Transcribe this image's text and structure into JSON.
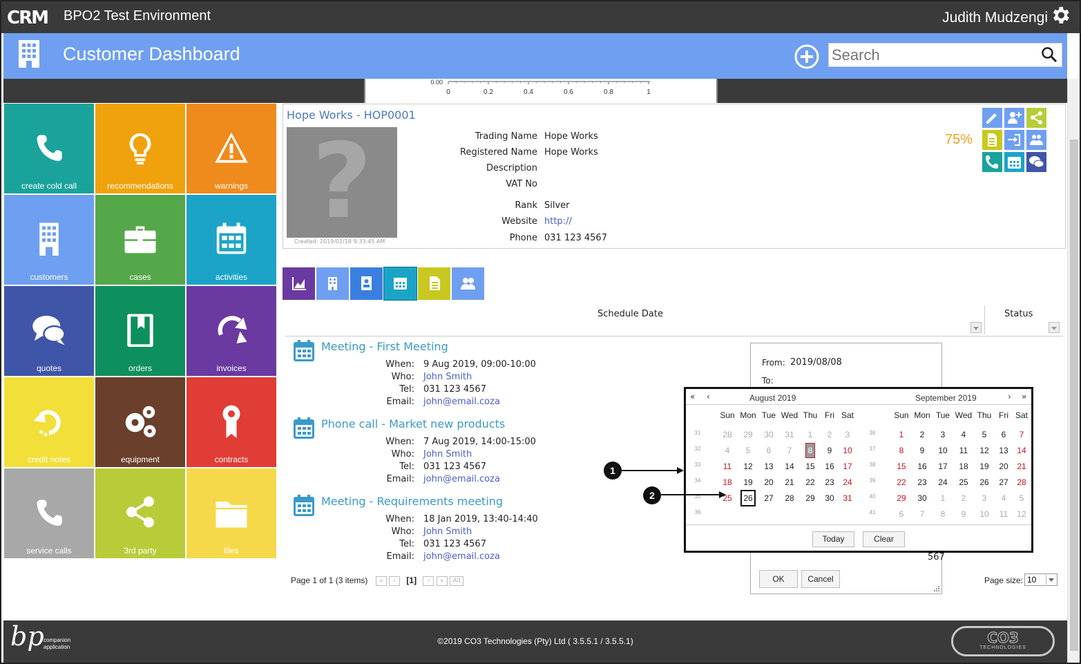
{
  "header": {
    "logo": "CRM",
    "environment": "BPO2 Test Environment",
    "user": "Judith Mudzengi"
  },
  "subheader": {
    "title": "Customer Dashboard",
    "search_placeholder": "Search"
  },
  "chart_axis": {
    "y_label": "0.00",
    "x_ticks": [
      "0",
      "0.2",
      "0.4",
      "0.6",
      "0.8",
      "1"
    ]
  },
  "tiles": [
    {
      "label": "create cold call",
      "color": "#1aa39a",
      "icon": "phone-icon"
    },
    {
      "label": "recommendations",
      "color": "#efa20c",
      "icon": "lightbulb-icon"
    },
    {
      "label": "warnings",
      "color": "#ef8a1c",
      "icon": "warning-icon"
    },
    {
      "label": "customers",
      "color": "#6f9ff0",
      "icon": "building-icon"
    },
    {
      "label": "cases",
      "color": "#55a84a",
      "icon": "briefcase-icon"
    },
    {
      "label": "activities",
      "color": "#1ba4c8",
      "icon": "calendar-icon"
    },
    {
      "label": "quotes",
      "color": "#3f55a8",
      "icon": "chat-icon"
    },
    {
      "label": "orders",
      "color": "#0e8f5e",
      "icon": "book-icon"
    },
    {
      "label": "invoices",
      "color": "#6a3aa0",
      "icon": "redo-icon"
    },
    {
      "label": "credit notes",
      "color": "#f3df3a",
      "icon": "undo-icon"
    },
    {
      "label": "equipment",
      "color": "#6a3f2c",
      "icon": "gears-icon"
    },
    {
      "label": "contracts",
      "color": "#e03d36",
      "icon": "ribbon-icon"
    },
    {
      "label": "service calls",
      "color": "#a8a8a8",
      "icon": "phone-icon"
    },
    {
      "label": "3rd party",
      "color": "#b8cc3a",
      "icon": "share-icon"
    },
    {
      "label": "files",
      "color": "#f6d94a",
      "icon": "folder-icon"
    }
  ],
  "customer": {
    "name": "Hope Works - HOP0001",
    "created": "Created: 2019/01/18 9:33:45 AM",
    "completion": "75%",
    "fields": [
      {
        "label": "Trading Name",
        "value": "Hope Works"
      },
      {
        "label": "Registered Name",
        "value": "Hope Works"
      },
      {
        "label": "Description",
        "value": ""
      },
      {
        "label": "VAT No",
        "value": ""
      },
      {
        "label": "Rank",
        "value": "Silver"
      },
      {
        "label": "Website",
        "value": "http://"
      },
      {
        "label": "Phone",
        "value": "031 123 4567"
      }
    ]
  },
  "grid": {
    "col_schedule": "Schedule Date",
    "col_status": "Status"
  },
  "activities": [
    {
      "title": "Meeting - First Meeting",
      "when": "9 Aug 2019, 09:00-10:00",
      "who": "John Smith",
      "tel": "031 123 4567",
      "email": "john@email.coza"
    },
    {
      "title": "Phone call - Market new products",
      "when": "7 Aug 2019, 14:00-15:00",
      "who": "John Smith",
      "tel": "031 123 4567",
      "email": "john@email.coza"
    },
    {
      "title": "Meeting - Requirements meeting",
      "when": "18 Jan 2019, 13:40-14:40",
      "who": "John Smith",
      "tel": "031 123 4567",
      "email": "john@email.coza"
    }
  ],
  "labels": {
    "when": "When:",
    "who": "Who:",
    "tel": "Tel:",
    "email": "Email:"
  },
  "pager": {
    "text": "Page 1 of 1 (3 items)",
    "current": "[1]",
    "all": "All",
    "page_size_label": "Page size:",
    "page_size": "10"
  },
  "filter": {
    "from_label": "From:",
    "from_value": "2019/08/08",
    "to_label": "To:",
    "partial": "567",
    "ok": "OK",
    "cancel": "Cancel"
  },
  "calendar": {
    "weekdays": [
      "Sun",
      "Mon",
      "Tue",
      "Wed",
      "Thu",
      "Fri",
      "Sat"
    ],
    "today": "Today",
    "clear": "Clear",
    "months": [
      {
        "title": "August 2019",
        "weeks": [
          "31",
          "32",
          "33",
          "34",
          "35",
          "36"
        ],
        "days": [
          [
            "28",
            "29",
            "30",
            "31",
            "1",
            "2",
            "3"
          ],
          [
            "4",
            "5",
            "6",
            "7",
            "8",
            "9",
            "10"
          ],
          [
            "11",
            "12",
            "13",
            "14",
            "15",
            "16",
            "17"
          ],
          [
            "18",
            "19",
            "20",
            "21",
            "22",
            "23",
            "24"
          ],
          [
            "25",
            "26",
            "27",
            "28",
            "29",
            "30",
            "31"
          ],
          [
            "",
            "",
            "",
            "",
            "",
            "",
            ""
          ]
        ],
        "other": [
          [
            1,
            1,
            1,
            1,
            1,
            1,
            1
          ],
          [
            1,
            1,
            1,
            1,
            0,
            0,
            0
          ],
          [
            0,
            0,
            0,
            0,
            0,
            0,
            0
          ],
          [
            0,
            0,
            0,
            0,
            0,
            0,
            0
          ],
          [
            0,
            0,
            0,
            0,
            0,
            0,
            0
          ],
          [
            0,
            0,
            0,
            0,
            0,
            0,
            0
          ]
        ]
      },
      {
        "title": "September 2019",
        "weeks": [
          "36",
          "37",
          "38",
          "39",
          "40",
          "41"
        ],
        "days": [
          [
            "1",
            "2",
            "3",
            "4",
            "5",
            "6",
            "7"
          ],
          [
            "8",
            "9",
            "10",
            "11",
            "12",
            "13",
            "14"
          ],
          [
            "15",
            "16",
            "17",
            "18",
            "19",
            "20",
            "21"
          ],
          [
            "22",
            "23",
            "24",
            "25",
            "26",
            "27",
            "28"
          ],
          [
            "29",
            "30",
            "1",
            "2",
            "3",
            "4",
            "5"
          ],
          [
            "6",
            "7",
            "8",
            "9",
            "10",
            "11",
            "12"
          ]
        ],
        "other": [
          [
            0,
            0,
            0,
            0,
            0,
            0,
            0
          ],
          [
            0,
            0,
            0,
            0,
            0,
            0,
            0
          ],
          [
            0,
            0,
            0,
            0,
            0,
            0,
            0
          ],
          [
            0,
            0,
            0,
            0,
            0,
            0,
            0
          ],
          [
            0,
            0,
            1,
            1,
            1,
            1,
            1
          ],
          [
            1,
            1,
            1,
            1,
            1,
            1,
            1
          ]
        ]
      }
    ]
  },
  "callouts": [
    "1",
    "2"
  ],
  "footer": {
    "copyright": "©2019 CO3 Technologies (Pty) Ltd ( 3.5.5.1 / 3.5.5.1)",
    "bp_line1": "companion",
    "bp_line2": "application",
    "co3_text": "TECHNOLOGIES"
  }
}
